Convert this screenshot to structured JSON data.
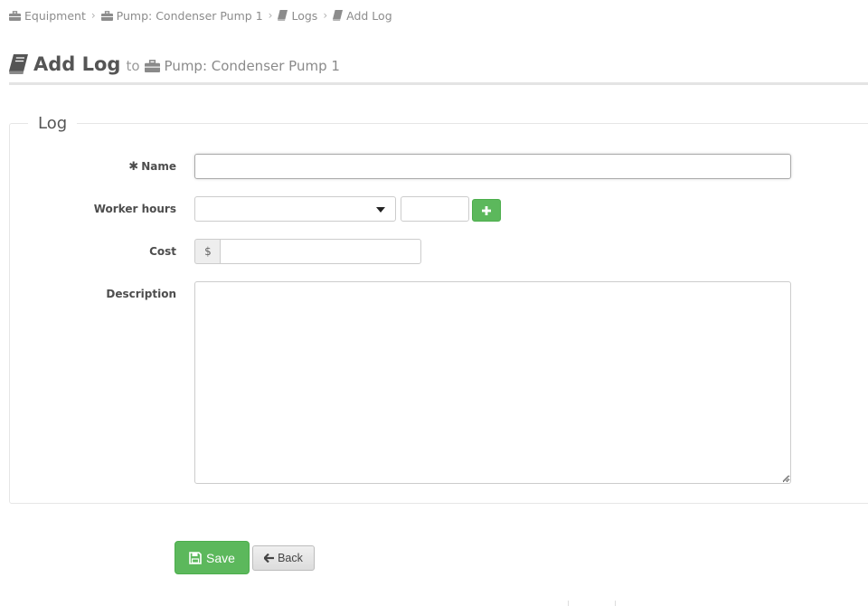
{
  "breadcrumb": [
    {
      "label": "Equipment",
      "icon": "briefcase-icon"
    },
    {
      "label": "Pump: Condenser Pump 1",
      "icon": "briefcase-icon"
    },
    {
      "label": "Logs",
      "icon": "book-icon"
    },
    {
      "label": "Add Log",
      "icon": "book-icon"
    }
  ],
  "header": {
    "title": "Add Log",
    "connector": "to",
    "target": "Pump: Condenser Pump 1",
    "title_icon": "book-icon",
    "target_icon": "briefcase-icon"
  },
  "form": {
    "legend": "Log",
    "name": {
      "label": "Name",
      "value": "",
      "required": true,
      "required_icon": "asterisk-icon"
    },
    "worker_hours": {
      "label": "Worker hours",
      "selected": "",
      "hours_value": "",
      "add_icon": "plus-icon"
    },
    "cost": {
      "label": "Cost",
      "currency": "$",
      "value": ""
    },
    "description": {
      "label": "Description",
      "value": ""
    }
  },
  "actions": {
    "save_label": "Save",
    "save_icon": "floppy-disk-icon",
    "back_label": "Back",
    "back_icon": "arrow-left-icon"
  },
  "colors": {
    "success": "#5cb85c",
    "text": "#555555",
    "muted": "#8c8c8c"
  }
}
